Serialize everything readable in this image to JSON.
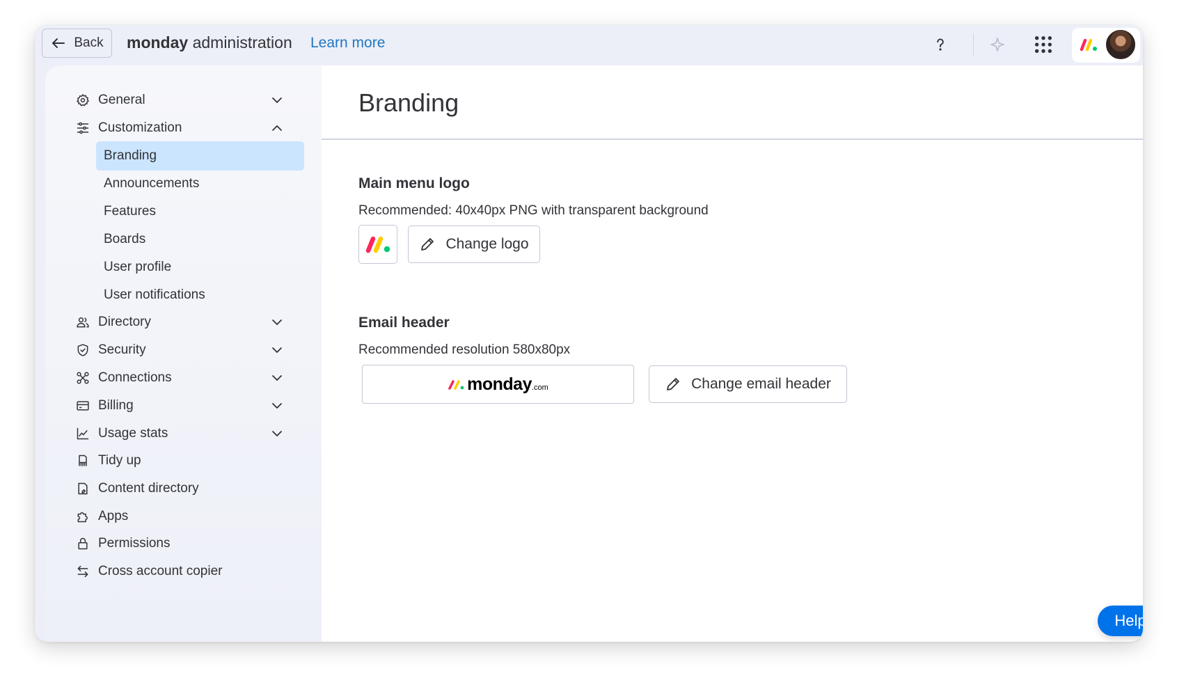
{
  "header": {
    "back_label": "Back",
    "app_brand": "monday",
    "app_title_rest": " administration",
    "learn_more": "Learn more"
  },
  "sidebar": {
    "items": [
      {
        "label": "General",
        "icon": "gear-icon",
        "expandable": true,
        "expanded": false
      },
      {
        "label": "Customization",
        "icon": "sliders-icon",
        "expandable": true,
        "expanded": true
      },
      {
        "label": "Directory",
        "icon": "users-icon",
        "expandable": true,
        "expanded": false
      },
      {
        "label": "Security",
        "icon": "shield-icon",
        "expandable": true,
        "expanded": false
      },
      {
        "label": "Connections",
        "icon": "connections-icon",
        "expandable": true,
        "expanded": false
      },
      {
        "label": "Billing",
        "icon": "credit-card-icon",
        "expandable": true,
        "expanded": false
      },
      {
        "label": "Usage stats",
        "icon": "chart-line-icon",
        "expandable": true,
        "expanded": false
      },
      {
        "label": "Tidy up",
        "icon": "broom-icon",
        "expandable": false
      },
      {
        "label": "Content directory",
        "icon": "document-icon",
        "expandable": false
      },
      {
        "label": "Apps",
        "icon": "puzzle-icon",
        "expandable": false
      },
      {
        "label": "Permissions",
        "icon": "lock-icon",
        "expandable": false
      },
      {
        "label": "Cross account copier",
        "icon": "arrows-swap-icon",
        "expandable": false
      }
    ],
    "sub_items": [
      {
        "label": "Branding",
        "active": true
      },
      {
        "label": "Announcements",
        "active": false
      },
      {
        "label": "Features",
        "active": false
      },
      {
        "label": "Boards",
        "active": false
      },
      {
        "label": "User profile",
        "active": false
      },
      {
        "label": "User notifications",
        "active": false
      }
    ]
  },
  "main": {
    "title": "Branding",
    "logo_section": {
      "title": "Main menu logo",
      "description": "Recommended: 40x40px PNG with transparent background",
      "button_label": "Change logo"
    },
    "email_section": {
      "title": "Email header",
      "description": "Recommended resolution 580x80px",
      "preview_wordmark": "monday",
      "preview_suffix": ".com",
      "button_label": "Change email header"
    }
  },
  "help_button": "Help",
  "colors": {
    "accent": "#0073ea",
    "active_nav": "#cce5ff",
    "link": "#1f76c2",
    "brand_red": "#fb275d",
    "brand_yellow": "#ffcc00",
    "brand_green": "#00ca72"
  }
}
